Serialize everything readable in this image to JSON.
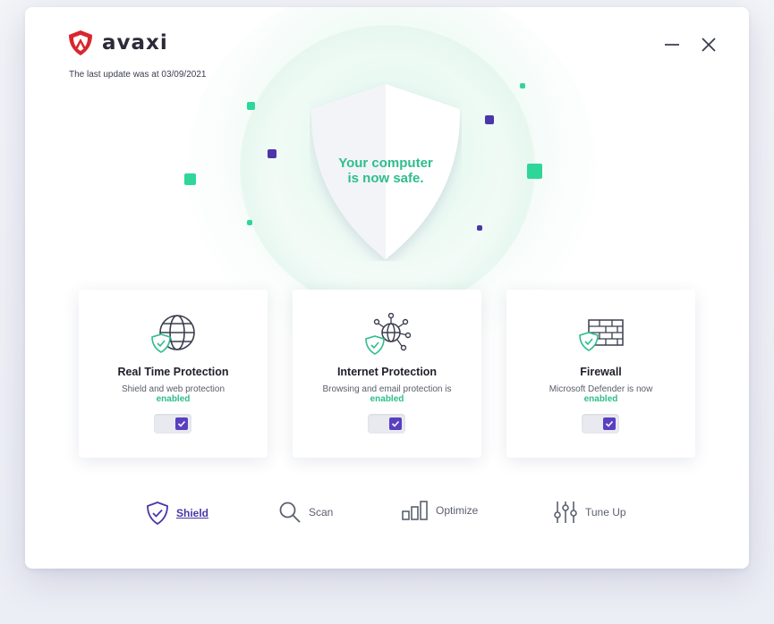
{
  "app": {
    "name": "avaxi",
    "brand_color": "#d9262c",
    "accent": "#2ebd8b",
    "primary": "#5a3fc0"
  },
  "header": {
    "last_update": "The last update was at 03/09/2021"
  },
  "window_controls": {
    "minimize_icon": "minimize-icon",
    "close_icon": "close-icon"
  },
  "status": {
    "line1": "Your computer",
    "line2": "is now safe."
  },
  "cards": [
    {
      "title": "Real Time Protection",
      "desc_prefix": "Shield and web protection",
      "desc_status": "enabled",
      "toggle_on": true,
      "icon": "globe-shield-icon"
    },
    {
      "title": "Internet Protection",
      "desc_prefix": "Browsing and email protection is",
      "desc_status": "enabled",
      "toggle_on": true,
      "icon": "network-shield-icon"
    },
    {
      "title": "Firewall",
      "desc_prefix": "Microsoft Defender is now",
      "desc_status": "enabled",
      "toggle_on": true,
      "icon": "firewall-shield-icon"
    }
  ],
  "nav": [
    {
      "label": "Shield",
      "icon": "shield-icon",
      "active": true
    },
    {
      "label": "Scan",
      "icon": "search-icon",
      "active": false
    },
    {
      "label": "Optimize",
      "icon": "bars-icon",
      "active": false
    },
    {
      "label": "Tune Up",
      "icon": "sliders-icon",
      "active": false
    }
  ]
}
